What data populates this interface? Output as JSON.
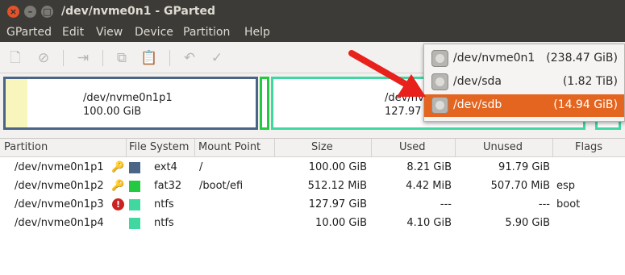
{
  "window": {
    "title": "/dev/nvme0n1 - GParted"
  },
  "menu": [
    "GParted",
    "Edit",
    "View",
    "Device",
    "Partition",
    "Help"
  ],
  "diskmap": {
    "p1": {
      "name": "/dev/nvme0n1p1",
      "size": "100.00 GiB"
    },
    "p3": {
      "name": "/dev/nvme0n1p3",
      "size": "127.97 GiB"
    }
  },
  "table": {
    "headers": [
      "Partition",
      "File System",
      "Mount Point",
      "Size",
      "Used",
      "Unused",
      "Flags"
    ],
    "rows": [
      {
        "partition": "/dev/nvme0n1p1",
        "fs": "ext4",
        "fs_color": "#4a6586",
        "mount": "/",
        "size": "100.00 GiB",
        "used": "8.21 GiB",
        "unused": "91.79 GiB",
        "flags": "",
        "icon": "key-icon"
      },
      {
        "partition": "/dev/nvme0n1p2",
        "fs": "fat32",
        "fs_color": "#23c940",
        "mount": "/boot/efi",
        "size": "512.12 MiB",
        "used": "4.42 MiB",
        "unused": "507.70 MiB",
        "flags": "esp",
        "icon": "key-icon"
      },
      {
        "partition": "/dev/nvme0n1p3",
        "fs": "ntfs",
        "fs_color": "#40d8a0",
        "mount": "",
        "size": "127.97 GiB",
        "used": "---",
        "unused": "---",
        "flags": "boot",
        "icon": "warning-icon"
      },
      {
        "partition": "/dev/nvme0n1p4",
        "fs": "ntfs",
        "fs_color": "#40d8a0",
        "mount": "",
        "size": "10.00 GiB",
        "used": "4.10 GiB",
        "unused": "5.90 GiB",
        "flags": "",
        "icon": ""
      }
    ]
  },
  "device_menu": {
    "items": [
      {
        "name": "/dev/nvme0n1",
        "size": "(238.47 GiB)"
      },
      {
        "name": "/dev/sda",
        "size": "(1.82 TiB)"
      },
      {
        "name": "/dev/sdb",
        "size": "(14.94 GiB)"
      }
    ],
    "selected_index": 2
  },
  "colors": {
    "accent": "#e4651f",
    "titlebar": "#3c3b37",
    "arrow": "#e8211c"
  }
}
